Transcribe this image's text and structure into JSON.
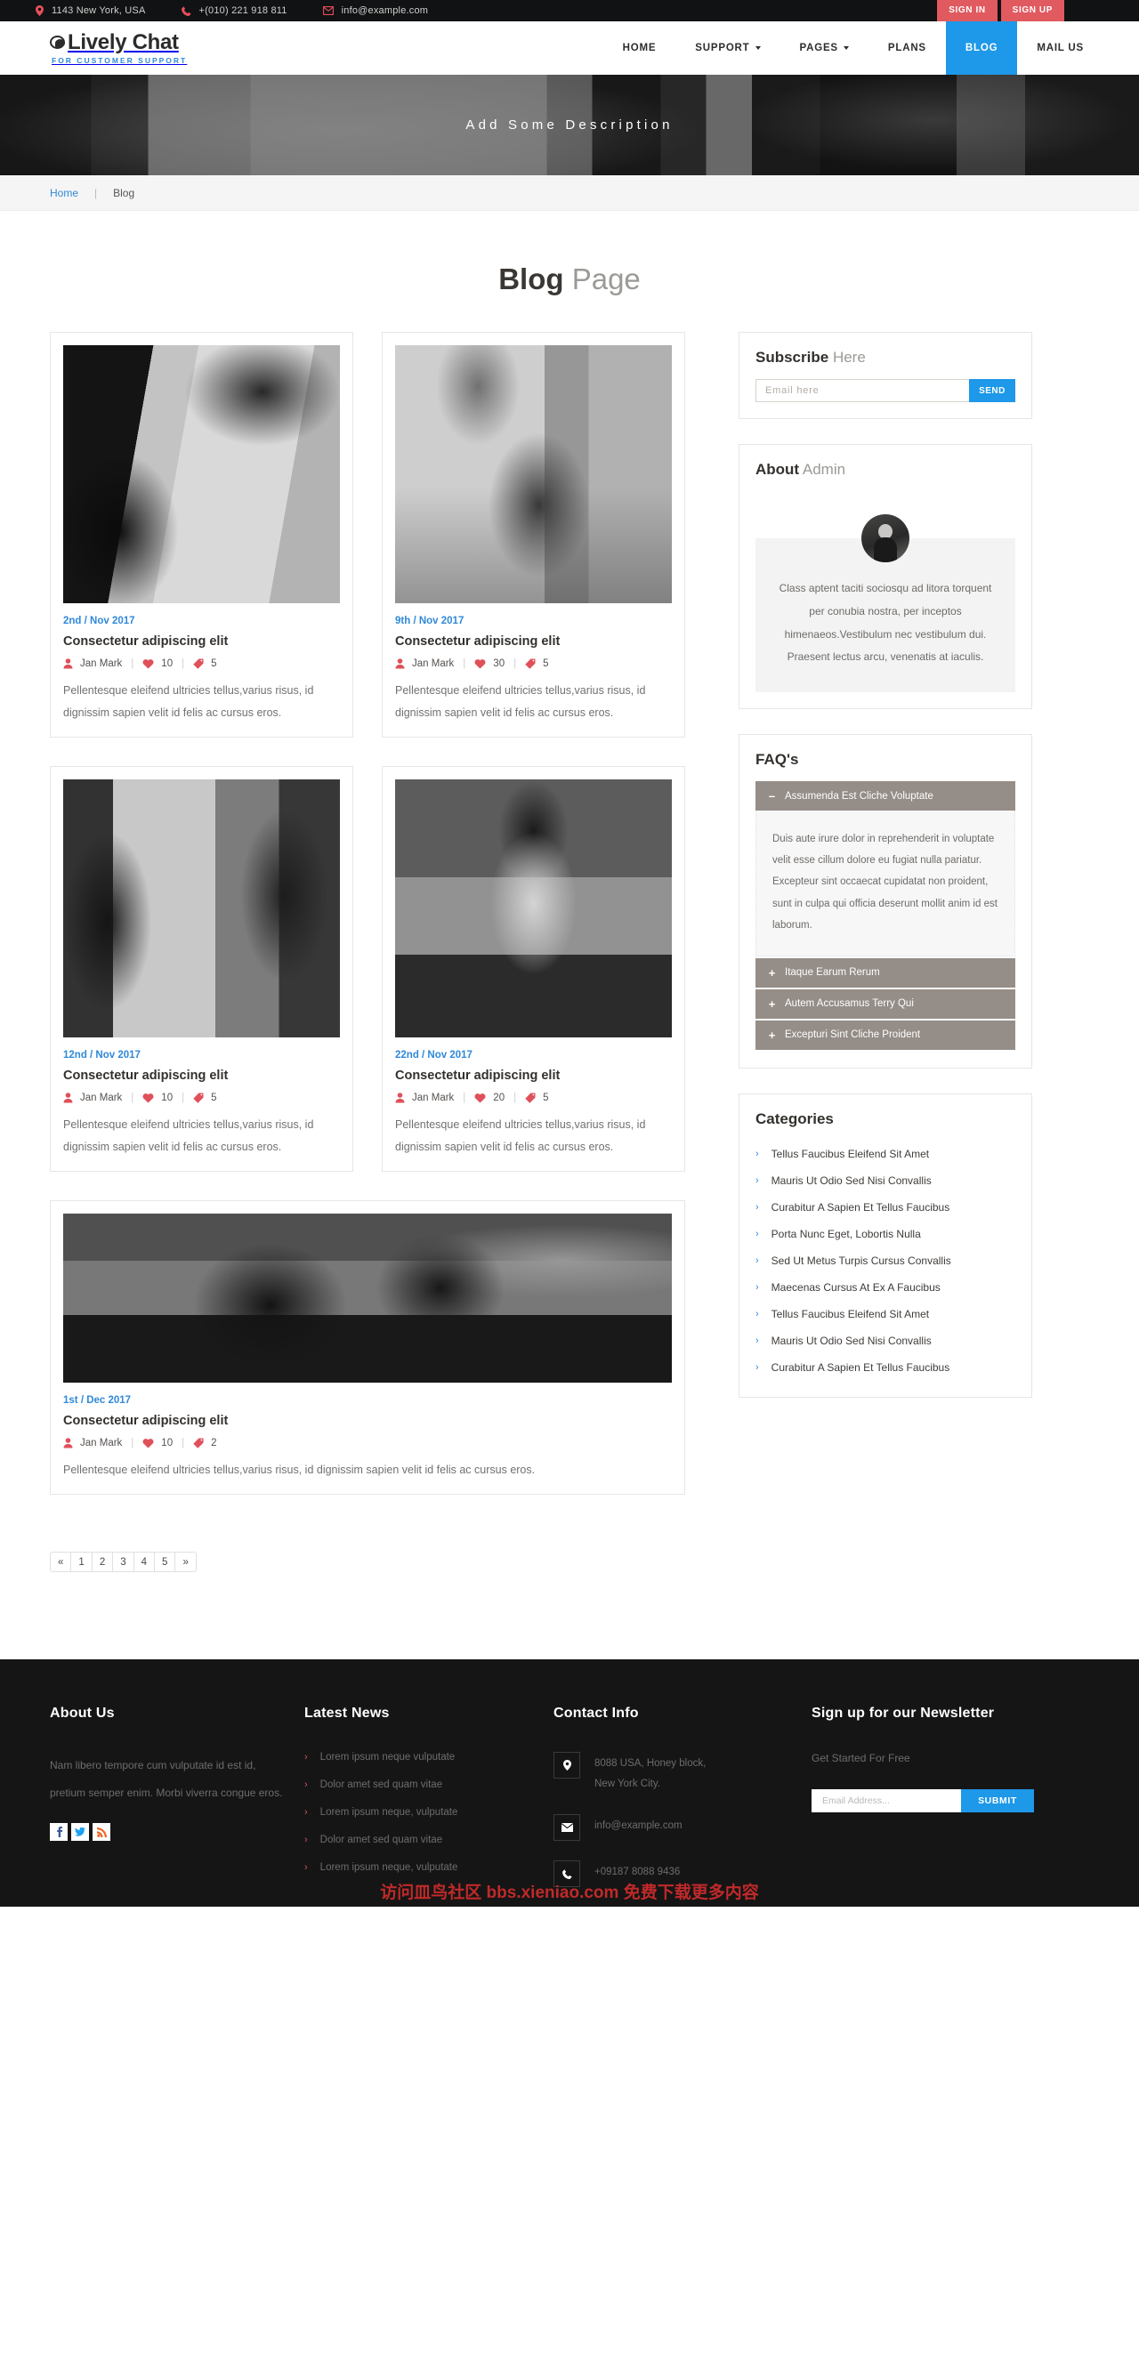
{
  "topbar": {
    "address": "1143 New York, USA",
    "phone": "+(010) 221 918 811",
    "email": "info@example.com",
    "sign_in": "SIGN IN",
    "sign_up": "SIGN UP",
    "accent": "#e05a5f"
  },
  "header": {
    "brand": "Lively Chat",
    "tagline": "FOR CUSTOMER SUPPORT",
    "nav": [
      {
        "label": "HOME",
        "caret": false,
        "active": false
      },
      {
        "label": "SUPPORT",
        "caret": true,
        "active": false
      },
      {
        "label": "PAGES",
        "caret": true,
        "active": false
      },
      {
        "label": "PLANS",
        "caret": false,
        "active": false
      },
      {
        "label": "BLOG",
        "caret": false,
        "active": true
      },
      {
        "label": "MAIL US",
        "caret": false,
        "active": false
      }
    ],
    "active_color": "#1e98e8"
  },
  "hero": {
    "title": "Add Some Description"
  },
  "breadcrumb": {
    "home": "Home",
    "sep": "|",
    "current": "Blog"
  },
  "page_title": {
    "bold": "Blog",
    "light": "Page"
  },
  "posts": [
    {
      "date": "2nd / Nov 2017",
      "title": "Consectetur adipiscing elit",
      "author": "Jan Mark",
      "likes": "10",
      "tags": "5",
      "excerpt": "Pellentesque eleifend ultricies tellus,varius risus, id dignissim sapien velit id felis ac cursus eros."
    },
    {
      "date": "9th / Nov 2017",
      "title": "Consectetur adipiscing elit",
      "author": "Jan Mark",
      "likes": "30",
      "tags": "5",
      "excerpt": "Pellentesque eleifend ultricies tellus,varius risus, id dignissim sapien velit id felis ac cursus eros."
    },
    {
      "date": "12nd / Nov 2017",
      "title": "Consectetur adipiscing elit",
      "author": "Jan Mark",
      "likes": "10",
      "tags": "5",
      "excerpt": "Pellentesque eleifend ultricies tellus,varius risus, id dignissim sapien velit id felis ac cursus eros."
    },
    {
      "date": "22nd / Nov 2017",
      "title": "Consectetur adipiscing elit",
      "author": "Jan Mark",
      "likes": "20",
      "tags": "5",
      "excerpt": "Pellentesque eleifend ultricies tellus,varius risus, id dignissim sapien velit id felis ac cursus eros."
    },
    {
      "date": "1st / Dec 2017",
      "title": "Consectetur adipiscing elit",
      "author": "Jan Mark",
      "likes": "10",
      "tags": "2",
      "excerpt": "Pellentesque eleifend ultricies tellus,varius risus, id dignissim sapien velit id felis ac cursus eros."
    }
  ],
  "pagination": [
    "«",
    "1",
    "2",
    "3",
    "4",
    "5",
    "»"
  ],
  "sidebar": {
    "subscribe": {
      "title_bold": "Subscribe",
      "title_light": "Here",
      "placeholder": "Email here",
      "button": "SEND"
    },
    "about_admin": {
      "title_bold": "About",
      "title_light": "Admin",
      "text": "Class aptent taciti sociosqu ad litora torquent per conubia nostra, per inceptos himenaeos.Vestibulum nec vestibulum dui. Praesent lectus arcu, venenatis at iaculis."
    },
    "faq": {
      "title": "FAQ's",
      "items": [
        {
          "sign": "–",
          "label": "Assumenda Est Cliche Voluptate",
          "open": true,
          "body": "Duis aute irure dolor in reprehenderit in voluptate velit esse cillum dolore eu fugiat nulla pariatur. Excepteur sint occaecat cupidatat non proident, sunt in culpa qui officia deserunt mollit anim id est laborum."
        },
        {
          "sign": "+",
          "label": "Itaque Earum Rerum",
          "open": false,
          "body": ""
        },
        {
          "sign": "+",
          "label": "Autem Accusamus Terry Qui",
          "open": false,
          "body": ""
        },
        {
          "sign": "+",
          "label": "Excepturi Sint Cliche Proident",
          "open": false,
          "body": ""
        }
      ]
    },
    "categories": {
      "title": "Categories",
      "items": [
        "Tellus Faucibus Eleifend Sit Amet",
        "Mauris Ut Odio Sed Nisi Convallis",
        "Curabitur A Sapien Et Tellus Faucibus",
        "Porta Nunc Eget, Lobortis Nulla",
        "Sed Ut Metus Turpis Cursus Convallis",
        "Maecenas Cursus At Ex A Faucibus",
        "Tellus Faucibus Eleifend Sit Amet",
        "Mauris Ut Odio Sed Nisi Convallis",
        "Curabitur A Sapien Et Tellus Faucibus"
      ]
    }
  },
  "footer": {
    "about": {
      "title": "About Us",
      "text": "Nam libero tempore cum vulputate id est id, pretium semper enim. Morbi viverra congue eros.",
      "socials": [
        "facebook-icon",
        "twitter-icon",
        "rss-icon"
      ]
    },
    "latest_news": {
      "title": "Latest News",
      "items": [
        "Lorem ipsum neque vulputate",
        "Dolor amet sed quam vitae",
        "Lorem ipsum neque, vulputate",
        "Dolor amet sed quam vitae",
        "Lorem ipsum neque, vulputate"
      ]
    },
    "contact": {
      "title": "Contact Info",
      "address_line1": "8088 USA, Honey block,",
      "address_line2": "New York City.",
      "email": "info@example.com",
      "phone": "+09187 8088 9436"
    },
    "newsletter": {
      "title": "Sign up for our Newsletter",
      "subtitle": "Get Started For Free",
      "placeholder": "Email Address...",
      "button": "SUBMIT"
    },
    "watermark": "访问皿鸟社区 bbs.xieniao.com 免费下载更多内容"
  }
}
